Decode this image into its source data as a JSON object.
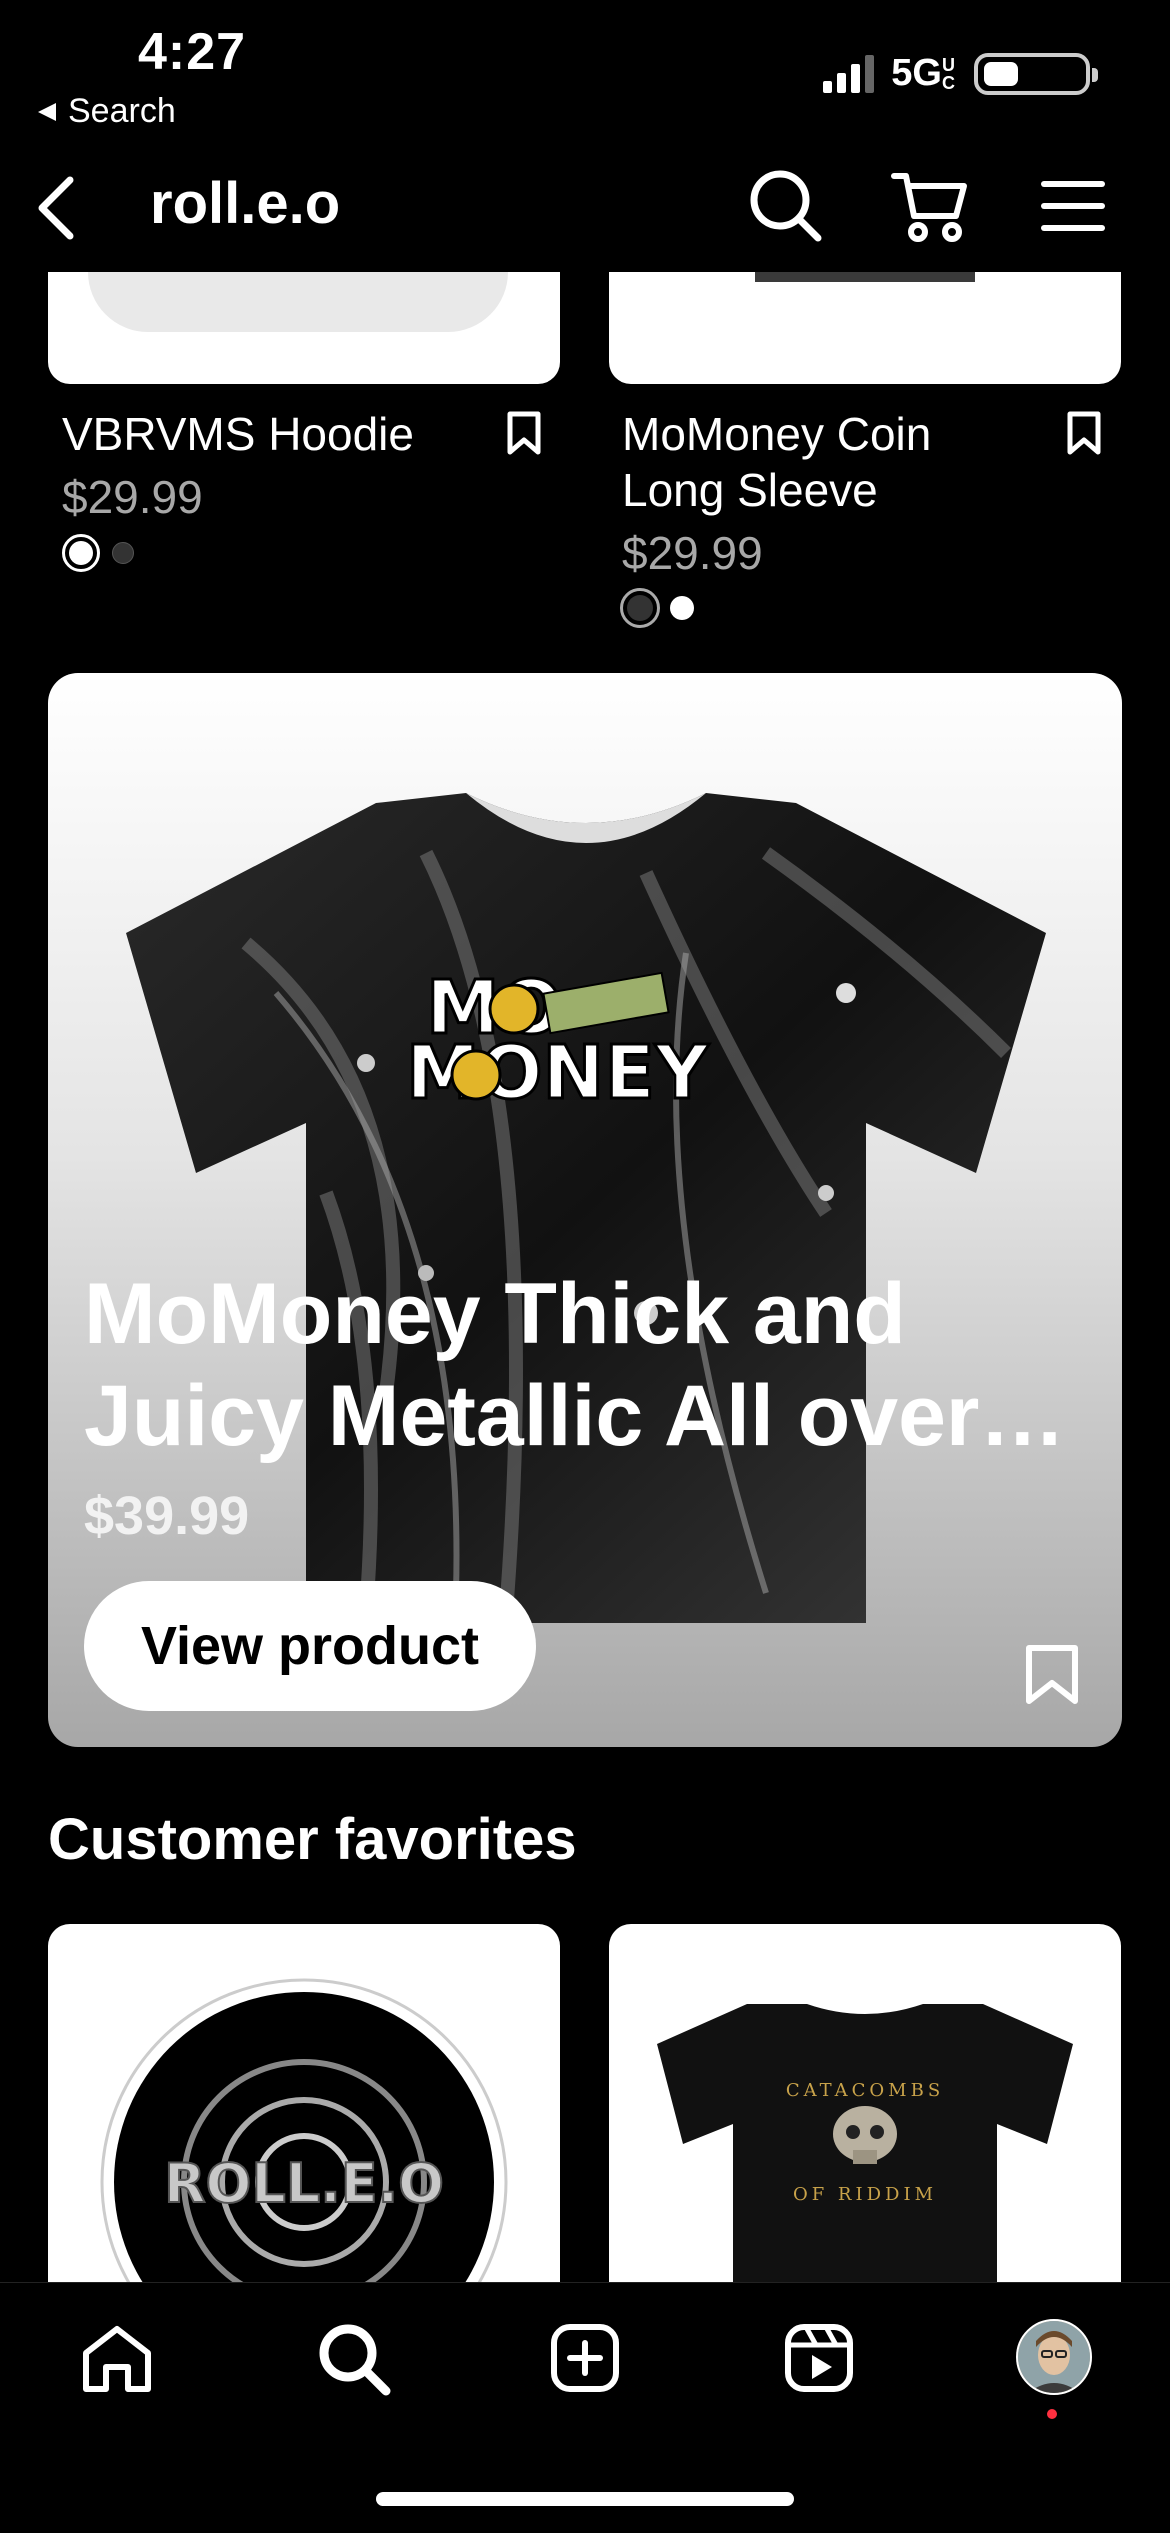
{
  "status": {
    "time": "4:27",
    "back_label": "Search",
    "network": "5G",
    "network_suffix": "UC",
    "battery_level": 0.35
  },
  "nav": {
    "title": "roll.e.o"
  },
  "products": [
    {
      "name": "VBRVMS Hoodie",
      "price": "$29.99",
      "swatches": [
        "#ffffff",
        "#333333"
      ],
      "selected_swatch": 0
    },
    {
      "name": "MoMoney Coin Long Sleeve",
      "name_line1": "MoMoney Coin",
      "name_line2": "Long Sleeve",
      "price": "$29.99",
      "swatches": [
        "#333333",
        "#ffffff"
      ],
      "selected_swatch": 0
    }
  ],
  "hero": {
    "title_line1": "MoMoney Thick and",
    "title_line2": "Juicy Metallic All over p...",
    "price": "$39.99",
    "button_label": "View product",
    "graphic_text_top": "MO",
    "graphic_text_bottom": "MONEY"
  },
  "favorites": {
    "title": "Customer favorites",
    "items": [
      {
        "graphic_text": "ROLL.E.O"
      },
      {
        "graphic_text_top": "CATACOMBS",
        "graphic_text_bottom": "OF RIDDIM"
      }
    ]
  },
  "tabbar": {
    "items": [
      "home",
      "search",
      "create",
      "reels",
      "profile"
    ]
  },
  "colors": {
    "background": "#000000",
    "price_gray": "#a8a8a8",
    "notification_dot": "#ff3040",
    "gold": "#c8a24a"
  }
}
